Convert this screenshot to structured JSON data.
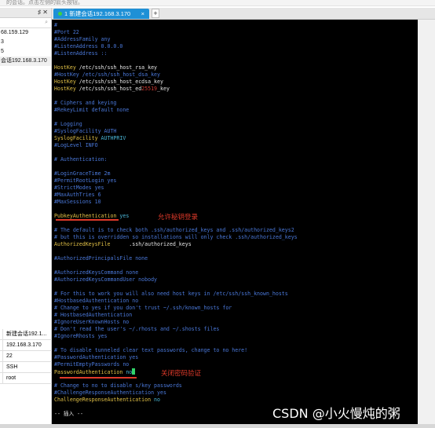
{
  "topbar": {
    "hint": "的会话。点击左侧的箭头按钮。"
  },
  "left_pane": {
    "pin_label": "♯ ✕",
    "search_icon": "⌕",
    "sessions": [
      "68.159.129",
      "3",
      "5",
      "会话192.168.3.170"
    ]
  },
  "properties": {
    "rows": [
      "新建会话192.1...",
      "192.168.3.170",
      "22",
      "SSH",
      "root"
    ]
  },
  "tab": {
    "title": "1 新建会话192.168.3.170",
    "close": "×",
    "add": "+"
  },
  "terminal": {
    "lines": [
      [
        {
          "t": "#",
          "c": "c-blue"
        }
      ],
      [
        {
          "t": "#Port 22",
          "c": "c-blue"
        }
      ],
      [
        {
          "t": "#AddressFamily any",
          "c": "c-blue"
        }
      ],
      [
        {
          "t": "#ListenAddress 0.0.0.0",
          "c": "c-blue"
        }
      ],
      [
        {
          "t": "#ListenAddress ::",
          "c": "c-blue"
        }
      ],
      [
        {
          "t": "",
          "c": "c-white"
        }
      ],
      [
        {
          "t": "HostKey",
          "c": "c-yellow"
        },
        {
          "t": " /etc/ssh/ssh_host_rsa_key",
          "c": "c-white"
        }
      ],
      [
        {
          "t": "#HostKey /etc/ssh/ssh_host_dsa_key",
          "c": "c-blue"
        }
      ],
      [
        {
          "t": "HostKey",
          "c": "c-yellow"
        },
        {
          "t": " /etc/ssh/ssh_host_ecdsa_key",
          "c": "c-white"
        }
      ],
      [
        {
          "t": "HostKey",
          "c": "c-yellow"
        },
        {
          "t": " /etc/ssh/ssh_host_ed",
          "c": "c-white"
        },
        {
          "t": "25519",
          "c": "c-red"
        },
        {
          "t": "_key",
          "c": "c-white"
        }
      ],
      [
        {
          "t": "",
          "c": "c-white"
        }
      ],
      [
        {
          "t": "# Ciphers and keying",
          "c": "c-blue"
        }
      ],
      [
        {
          "t": "#RekeyLimit default none",
          "c": "c-blue"
        }
      ],
      [
        {
          "t": "",
          "c": "c-white"
        }
      ],
      [
        {
          "t": "# Logging",
          "c": "c-blue"
        }
      ],
      [
        {
          "t": "#SyslogFacility AUTH",
          "c": "c-blue"
        }
      ],
      [
        {
          "t": "SyslogFacility",
          "c": "c-yellow"
        },
        {
          "t": " AUTHPRIV",
          "c": "c-cyan"
        }
      ],
      [
        {
          "t": "#LogLevel INFO",
          "c": "c-blue"
        }
      ],
      [
        {
          "t": "",
          "c": "c-white"
        }
      ],
      [
        {
          "t": "# Authentication:",
          "c": "c-blue"
        }
      ],
      [
        {
          "t": "",
          "c": "c-white"
        }
      ],
      [
        {
          "t": "#LoginGraceTime 2m",
          "c": "c-blue"
        }
      ],
      [
        {
          "t": "#PermitRootLogin yes",
          "c": "c-blue"
        }
      ],
      [
        {
          "t": "#StrictModes yes",
          "c": "c-blue"
        }
      ],
      [
        {
          "t": "#MaxAuthTries 6",
          "c": "c-blue"
        }
      ],
      [
        {
          "t": "#MaxSessions 10",
          "c": "c-blue"
        }
      ],
      [
        {
          "t": "",
          "c": "c-white"
        }
      ],
      [
        {
          "t": "PubkeyAuthentication",
          "c": "c-yellow"
        },
        {
          "t": " yes",
          "c": "c-cyan"
        }
      ],
      [
        {
          "t": "",
          "c": "c-white"
        }
      ],
      [
        {
          "t": "# The default is to check both .ssh/authorized_keys and .ssh/authorized_keys2",
          "c": "c-blue"
        }
      ],
      [
        {
          "t": "# but this is overridden so installations will only check .ssh/authorized_keys",
          "c": "c-blue"
        }
      ],
      [
        {
          "t": "AuthorizedKeysFile",
          "c": "c-yellow"
        },
        {
          "t": "      .ssh/authorized_keys",
          "c": "c-white"
        }
      ],
      [
        {
          "t": "",
          "c": "c-white"
        }
      ],
      [
        {
          "t": "#AuthorizedPrincipalsFile none",
          "c": "c-blue"
        }
      ],
      [
        {
          "t": "",
          "c": "c-white"
        }
      ],
      [
        {
          "t": "#AuthorizedKeysCommand none",
          "c": "c-blue"
        }
      ],
      [
        {
          "t": "#AuthorizedKeysCommandUser nobody",
          "c": "c-blue"
        }
      ],
      [
        {
          "t": "",
          "c": "c-white"
        }
      ],
      [
        {
          "t": "# For this to work you will also need host keys in /etc/ssh/ssh_known_hosts",
          "c": "c-blue"
        }
      ],
      [
        {
          "t": "#HostbasedAuthentication no",
          "c": "c-blue"
        }
      ],
      [
        {
          "t": "# Change to yes if you don't trust ~/.ssh/known_hosts for",
          "c": "c-blue"
        }
      ],
      [
        {
          "t": "# HostbasedAuthentication",
          "c": "c-blue"
        }
      ],
      [
        {
          "t": "#IgnoreUserKnownHosts no",
          "c": "c-blue"
        }
      ],
      [
        {
          "t": "# Don't read the user's ~/.rhosts and ~/.shosts files",
          "c": "c-blue"
        }
      ],
      [
        {
          "t": "#IgnoreRhosts yes",
          "c": "c-blue"
        }
      ],
      [
        {
          "t": "",
          "c": "c-white"
        }
      ],
      [
        {
          "t": "# To disable tunneled clear text passwords, change to no here!",
          "c": "c-blue"
        }
      ],
      [
        {
          "t": "#PasswordAuthentication yes",
          "c": "c-blue"
        }
      ],
      [
        {
          "t": "#PermitEmptyPasswords no",
          "c": "c-blue"
        }
      ],
      [
        {
          "t": "PasswordAuthentication",
          "c": "c-yellow"
        },
        {
          "t": " no",
          "c": "c-cyan"
        },
        {
          "cursor": true
        }
      ],
      [
        {
          "t": "",
          "c": "c-white"
        }
      ],
      [
        {
          "t": "# Change to no to disable s/key passwords",
          "c": "c-blue"
        }
      ],
      [
        {
          "t": "#ChallengeResponseAuthentication yes",
          "c": "c-blue"
        }
      ],
      [
        {
          "t": "ChallengeResponseAuthentication",
          "c": "c-yellow"
        },
        {
          "t": " no",
          "c": "c-cyan"
        }
      ],
      [
        {
          "t": "",
          "c": "c-white"
        }
      ],
      [
        {
          "t": "-- 插入 --",
          "c": "c-white"
        }
      ]
    ]
  },
  "annotations": {
    "pubkey_note": "允许秘钥登录",
    "password_note": "关闭密码验证"
  },
  "watermark": "CSDN @小火慢炖的粥"
}
